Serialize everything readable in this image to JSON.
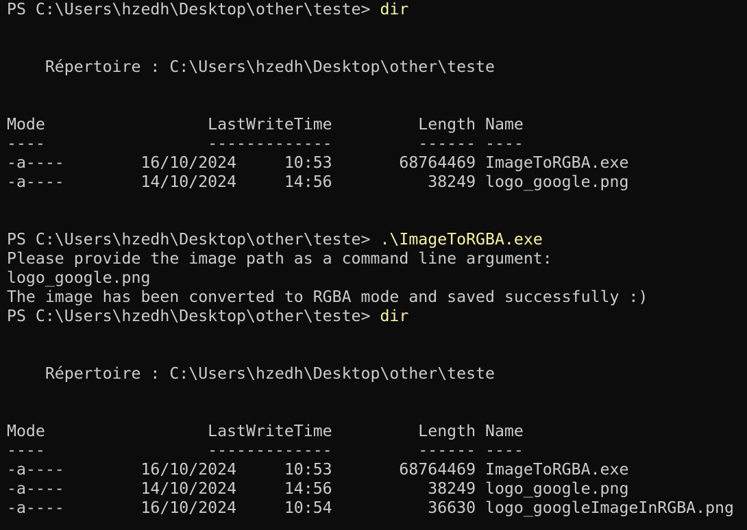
{
  "terminal": {
    "colors": {
      "background": "#0c0c0c",
      "foreground": "#cccccc",
      "command": "#f9f1a5"
    },
    "lines": [
      {
        "prompt": "PS C:\\Users\\hzedh\\Desktop\\other\\teste> ",
        "cmd": "dir"
      },
      {
        "text": ""
      },
      {
        "text": ""
      },
      {
        "text": "    Répertoire : C:\\Users\\hzedh\\Desktop\\other\\teste"
      },
      {
        "text": ""
      },
      {
        "text": ""
      },
      {
        "text": "Mode                 LastWriteTime         Length Name"
      },
      {
        "text": "----                 -------------         ------ ----"
      },
      {
        "text": "-a----        16/10/2024     10:53       68764469 ImageToRGBA.exe"
      },
      {
        "text": "-a----        14/10/2024     14:56          38249 logo_google.png"
      },
      {
        "text": ""
      },
      {
        "text": ""
      },
      {
        "prompt": "PS C:\\Users\\hzedh\\Desktop\\other\\teste> ",
        "cmd": ".\\ImageToRGBA.exe"
      },
      {
        "text": "Please provide the image path as a command line argument:"
      },
      {
        "text": "logo_google.png"
      },
      {
        "text": "The image has been converted to RGBA mode and saved successfully :)"
      },
      {
        "prompt": "PS C:\\Users\\hzedh\\Desktop\\other\\teste> ",
        "cmd": "dir"
      },
      {
        "text": ""
      },
      {
        "text": ""
      },
      {
        "text": "    Répertoire : C:\\Users\\hzedh\\Desktop\\other\\teste"
      },
      {
        "text": ""
      },
      {
        "text": ""
      },
      {
        "text": "Mode                 LastWriteTime         Length Name"
      },
      {
        "text": "----                 -------------         ------ ----"
      },
      {
        "text": "-a----        16/10/2024     10:53       68764469 ImageToRGBA.exe"
      },
      {
        "text": "-a----        14/10/2024     14:56          38249 logo_google.png"
      },
      {
        "text": "-a----        16/10/2024     10:54          36630 logo_googleImageInRGBA.png"
      }
    ]
  }
}
